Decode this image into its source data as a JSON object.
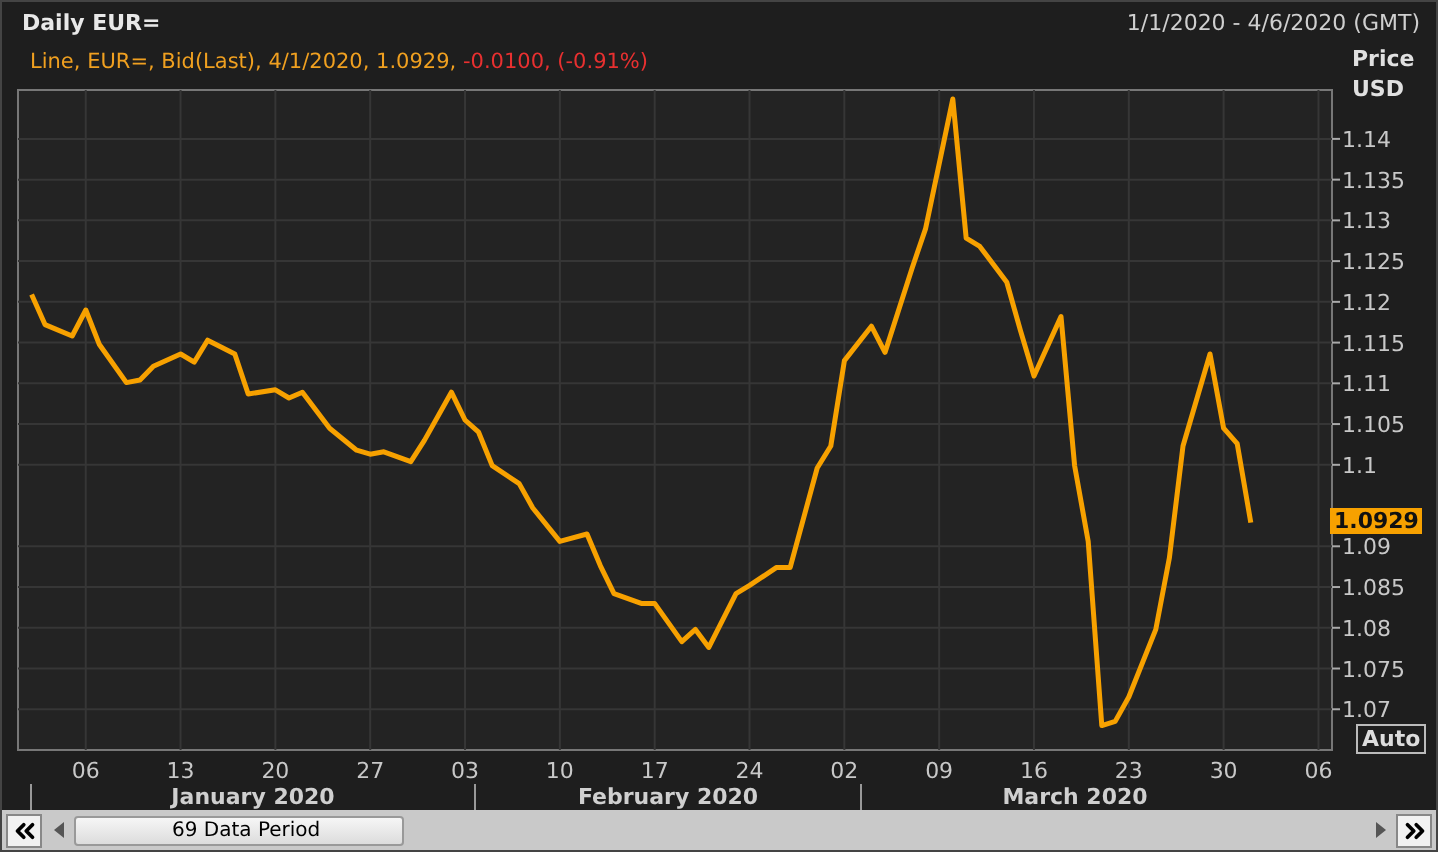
{
  "header": {
    "title": "Daily EUR=",
    "range": "1/1/2020 - 4/6/2020 (GMT)"
  },
  "legend": {
    "prefix": "Line,",
    "suffix": ", Bid(Last), 4/1/2020, 1.0929,",
    "change": "-0.0100, (-0.91%)"
  },
  "chart": {
    "last_price": "1.0929",
    "scale_button": "Auto",
    "months": [
      "January 2020",
      "February 2020",
      "March 2020"
    ],
    "chart_data": {
      "type": "line",
      "ylabel": "Price USD",
      "grid": true,
      "x": [
        "2020-01-02",
        "2020-01-03",
        "2020-01-05",
        "2020-01-06",
        "2020-01-07",
        "2020-01-09",
        "2020-01-10",
        "2020-01-11",
        "2020-01-13",
        "2020-01-14",
        "2020-01-15",
        "2020-01-17",
        "2020-01-18",
        "2020-01-20",
        "2020-01-21",
        "2020-01-22",
        "2020-01-23",
        "2020-01-24",
        "2020-01-26",
        "2020-01-27",
        "2020-01-28",
        "2020-01-30",
        "2020-01-31",
        "2020-02-02",
        "2020-02-03",
        "2020-02-04",
        "2020-02-05",
        "2020-02-07",
        "2020-02-08",
        "2020-02-10",
        "2020-02-12",
        "2020-02-13",
        "2020-02-14",
        "2020-02-16",
        "2020-02-17",
        "2020-02-19",
        "2020-02-20",
        "2020-02-21",
        "2020-02-23",
        "2020-02-24",
        "2020-02-26",
        "2020-02-27",
        "2020-02-29",
        "2020-03-01",
        "2020-03-02",
        "2020-03-04",
        "2020-03-05",
        "2020-03-07",
        "2020-03-08",
        "2020-03-10",
        "2020-03-11",
        "2020-03-12",
        "2020-03-14",
        "2020-03-15",
        "2020-03-16",
        "2020-03-18",
        "2020-03-19",
        "2020-03-20",
        "2020-03-21",
        "2020-03-22",
        "2020-03-23",
        "2020-03-25",
        "2020-03-26",
        "2020-03-27",
        "2020-03-29",
        "2020-03-30",
        "2020-03-31",
        "2020-04-01"
      ],
      "series": [
        {
          "name": "EUR=",
          "color": "#f7a100",
          "values": [
            1.1209,
            1.1172,
            1.1158,
            1.119,
            1.1148,
            1.1101,
            1.1104,
            1.1121,
            1.1136,
            1.1126,
            1.1153,
            1.1136,
            1.1087,
            1.1092,
            1.1082,
            1.1089,
            1.1067,
            1.1045,
            1.1018,
            1.1013,
            1.1016,
            1.1004,
            1.103,
            1.1089,
            1.1055,
            1.104,
            1.0999,
            1.0977,
            1.0947,
            1.0906,
            1.0915,
            1.0876,
            1.0842,
            1.083,
            1.083,
            1.0783,
            1.0798,
            1.0776,
            1.0842,
            1.0852,
            1.0874,
            1.0874,
            1.0996,
            1.1023,
            1.1128,
            1.117,
            1.1138,
            1.1241,
            1.129,
            1.1449,
            1.1278,
            1.1268,
            1.1224,
            1.1165,
            1.1109,
            1.1182,
            1.0999,
            1.0906,
            1.068,
            1.0685,
            1.0715,
            1.0798,
            1.0886,
            1.1023,
            1.1136,
            1.1045,
            1.1026,
            1.0929
          ]
        }
      ],
      "xlim": [
        "2020-01-01",
        "2020-04-07"
      ],
      "ylim": [
        1.065,
        1.146
      ],
      "xticks": [
        {
          "value": "2020-01-06",
          "label": "06"
        },
        {
          "value": "2020-01-13",
          "label": "13"
        },
        {
          "value": "2020-01-20",
          "label": "20"
        },
        {
          "value": "2020-01-27",
          "label": "27"
        },
        {
          "value": "2020-02-03",
          "label": "03"
        },
        {
          "value": "2020-02-10",
          "label": "10"
        },
        {
          "value": "2020-02-17",
          "label": "17"
        },
        {
          "value": "2020-02-24",
          "label": "24"
        },
        {
          "value": "2020-03-02",
          "label": "02"
        },
        {
          "value": "2020-03-09",
          "label": "09"
        },
        {
          "value": "2020-03-16",
          "label": "16"
        },
        {
          "value": "2020-03-23",
          "label": "23"
        },
        {
          "value": "2020-03-30",
          "label": "30"
        },
        {
          "value": "2020-04-06",
          "label": "06"
        }
      ],
      "yticks": [
        1.07,
        1.075,
        1.08,
        1.085,
        1.09,
        1.1,
        1.105,
        1.11,
        1.115,
        1.12,
        1.125,
        1.13,
        1.135,
        1.14
      ]
    }
  },
  "scrollbar": {
    "label": "69 Data Period"
  }
}
